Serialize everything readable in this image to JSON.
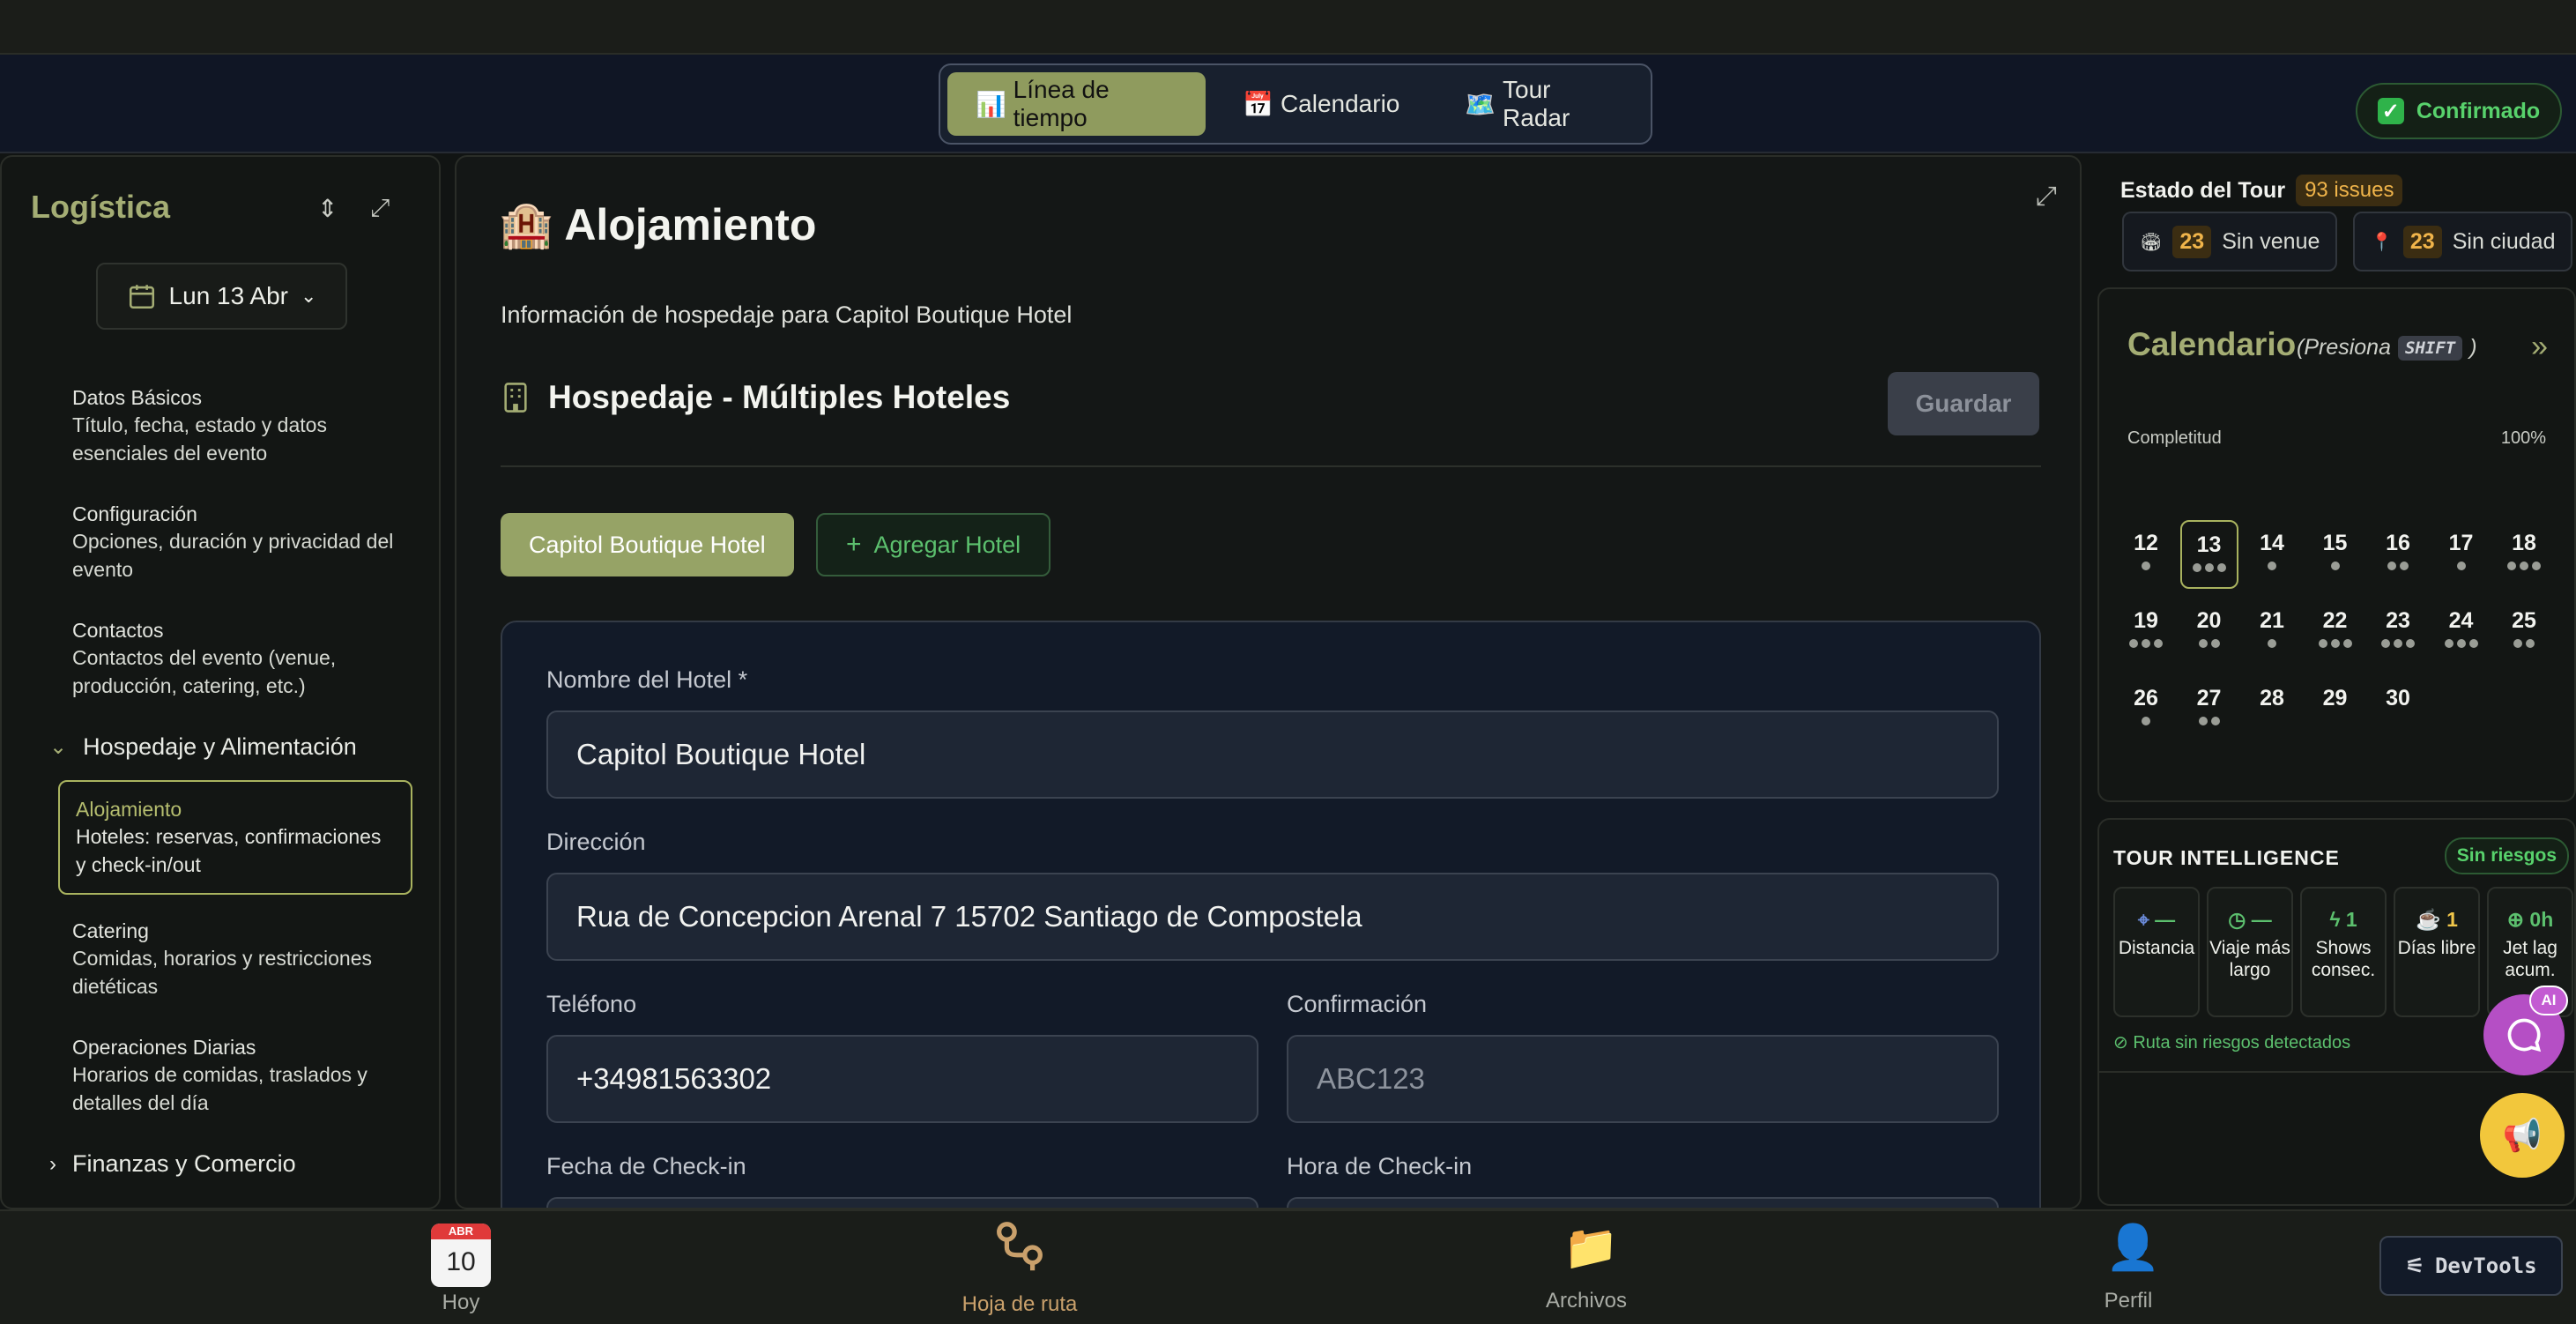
{
  "header": {
    "tabs": [
      {
        "icon": "📊",
        "label": "Línea de tiempo",
        "active": true
      },
      {
        "icon": "📅",
        "label": "Calendario",
        "active": false
      },
      {
        "icon": "🗺️",
        "label": "Tour Radar",
        "active": false
      }
    ],
    "status": "Confirmado"
  },
  "sidebar": {
    "title": "Logística",
    "date": "Lun 13 Abr",
    "items": [
      {
        "title": "Datos Básicos",
        "desc": "Título, fecha, estado y datos esenciales del evento"
      },
      {
        "title": "Configuración",
        "desc": "Opciones, duración y privacidad del evento"
      },
      {
        "title": "Contactos",
        "desc": "Contactos del evento (venue, producción, catering, etc.)"
      }
    ],
    "group": "Hospedaje y Alimentación",
    "active_item": {
      "title": "Alojamiento",
      "desc": "Hoteles: reservas, confirmaciones y check-in/out"
    },
    "items2": [
      {
        "title": "Catering",
        "desc": "Comidas, horarios y restricciones dietéticas"
      },
      {
        "title": "Operaciones Diarias",
        "desc": "Horarios de comidas, traslados y detalles del día"
      }
    ],
    "group2": "Finanzas y Comercio"
  },
  "main": {
    "icon": "🏨",
    "title": "Alojamiento",
    "subtitle": "Información de hospedaje para Capitol Boutique Hotel",
    "section_title": "Hospedaje - Múltiples Hoteles",
    "save_label": "Guardar",
    "hotel_tab": "Capitol Boutique Hotel",
    "add_hotel": "Agregar Hotel",
    "form": {
      "name_label": "Nombre del Hotel *",
      "name_value": "Capitol Boutique Hotel",
      "address_label": "Dirección",
      "address_value": "Rua de Concepcion Arenal 7 15702 Santiago de Compostela",
      "phone_label": "Teléfono",
      "phone_value": "+34981563302",
      "confirm_label": "Confirmación",
      "confirm_placeholder": "ABC123",
      "checkin_date_label": "Fecha de Check-in",
      "checkin_time_label": "Hora de Check-in"
    }
  },
  "tour_status": {
    "title": "Estado del Tour",
    "issues": "93 issues",
    "chips": [
      {
        "icon": "🏟",
        "count": "23",
        "label": "Sin venue"
      },
      {
        "icon": "📍",
        "count": "23",
        "label": "Sin ciudad"
      }
    ]
  },
  "calendar": {
    "title": "Calendario",
    "hint_pre": "(Presiona",
    "hint_key": "SHIFT",
    "hint_post": ")",
    "progress_label": "Completitud",
    "progress_value": "100%",
    "days": [
      {
        "n": "12",
        "dots": 1
      },
      {
        "n": "13",
        "dots": 3,
        "today": true
      },
      {
        "n": "14",
        "dots": 1
      },
      {
        "n": "15",
        "dots": 1
      },
      {
        "n": "16",
        "dots": 2
      },
      {
        "n": "17",
        "dots": 1
      },
      {
        "n": "18",
        "dots": 3
      },
      {
        "n": "19",
        "dots": 3
      },
      {
        "n": "20",
        "dots": 2
      },
      {
        "n": "21",
        "dots": 1
      },
      {
        "n": "22",
        "dots": 3
      },
      {
        "n": "23",
        "dots": 3
      },
      {
        "n": "24",
        "dots": 3
      },
      {
        "n": "25",
        "dots": 2
      },
      {
        "n": "26",
        "dots": 1
      },
      {
        "n": "27",
        "dots": 2
      },
      {
        "n": "28",
        "dots": 0
      },
      {
        "n": "29",
        "dots": 0
      },
      {
        "n": "30",
        "dots": 0
      }
    ]
  },
  "intelligence": {
    "title": "TOUR INTELLIGENCE",
    "badge": "Sin riesgos",
    "metrics": [
      {
        "icon": "⌖",
        "value": "—",
        "label": "Distancia",
        "color": "green"
      },
      {
        "icon": "◷",
        "value": "—",
        "label": "Viaje más largo",
        "color": "green"
      },
      {
        "icon": "ϟ",
        "value": "1",
        "label": "Shows consec.",
        "color": "green"
      },
      {
        "icon": "☕",
        "value": "1",
        "label": "Días libre",
        "color": "yellow"
      },
      {
        "icon": "⊕",
        "value": "0h",
        "label": "Jet lag acum.",
        "color": "green"
      }
    ],
    "ok_text": "Ruta sin riesgos detectados"
  },
  "fab": {
    "ai_badge": "AI"
  },
  "bottom_nav": {
    "today_month": "ABR",
    "today_day": "10",
    "items": [
      "Hoy",
      "Hoja de ruta",
      "Archivos",
      "Perfil"
    ],
    "devtools": "DevTools"
  }
}
